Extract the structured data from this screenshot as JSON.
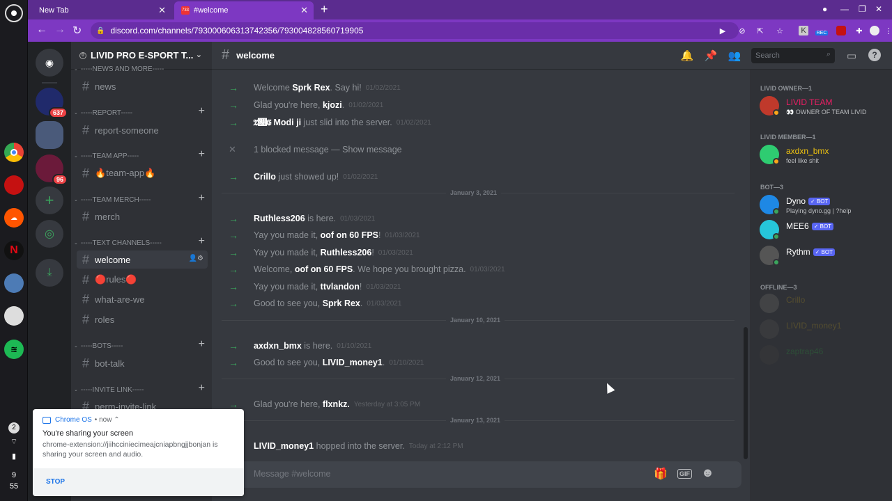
{
  "browser": {
    "tabs": [
      {
        "title": "New Tab"
      },
      {
        "title": "#welcome",
        "badge": "733"
      }
    ],
    "url": "discord.com/channels/793000606313742356/793004828560719905",
    "ext_rec": "REC"
  },
  "os": {
    "notif_count": "2",
    "clock_hour": "9",
    "clock_min": "55"
  },
  "guilds": [
    {
      "badge": "637"
    },
    {
      "badge": null
    },
    {
      "badge": "96"
    }
  ],
  "server": {
    "name": "LIVID PRO E-SPORT T...",
    "categories": [
      {
        "name": "-----NEWS AND MORE-----",
        "channels": [
          "news"
        ]
      },
      {
        "name": "-----REPORT-----",
        "channels": [
          "report-someone"
        ]
      },
      {
        "name": "-----TEAM APP-----",
        "channels": [
          "🔥team-app🔥"
        ]
      },
      {
        "name": "-----TEAM MERCH-----",
        "channels": [
          "merch"
        ]
      },
      {
        "name": "-----TEXT CHANNELS-----",
        "channels": [
          "welcome",
          "🔴rules🔴",
          "what-are-we",
          "roles"
        ]
      },
      {
        "name": "-----BOTS-----",
        "channels": [
          "bot-talk"
        ]
      },
      {
        "name": "-----INVITE LINK-----",
        "channels": [
          "perm-invite-link"
        ]
      }
    ]
  },
  "chat": {
    "channel": "welcome",
    "search_placeholder": "Search",
    "composer_placeholder": "Message #welcome",
    "composer_gif": "GIF",
    "messages": [
      {
        "pre": "Welcome ",
        "name": "Sprk Rex",
        "post": ". Say hi!",
        "ts": "01/02/2021"
      },
      {
        "pre": "Glad you're here, ",
        "name": "kjozi",
        "post": ".",
        "ts": "01/02/2021"
      },
      {
        "pre": "",
        "name": "𝔗𝔋𝔈 Modi ji",
        "post": " just slid into the server.",
        "ts": "01/02/2021"
      },
      {
        "pre": "1 blocked message — ",
        "name": "",
        "post": "Show message",
        "ts": ""
      },
      {
        "pre": "",
        "name": "Crillo",
        "post": " just showed up!",
        "ts": "01/02/2021"
      },
      {
        "pre": "",
        "name": "Ruthless206",
        "post": " is here.",
        "ts": "01/03/2021"
      },
      {
        "pre": "Yay you made it, ",
        "name": "oof on 60 FPS",
        "post": "!",
        "ts": "01/03/2021"
      },
      {
        "pre": "Yay you made it, ",
        "name": "Ruthless206",
        "post": "!",
        "ts": "01/03/2021"
      },
      {
        "pre": "Welcome, ",
        "name": "oof on 60 FPS",
        "post": ". We hope you brought pizza.",
        "ts": "01/03/2021"
      },
      {
        "pre": "Yay you made it, ",
        "name": "ttvlandon",
        "post": "!",
        "ts": "01/03/2021"
      },
      {
        "pre": "Good to see you, ",
        "name": "Sprk Rex",
        "post": ".",
        "ts": "01/03/2021"
      },
      {
        "pre": "",
        "name": "axdxn_bmx",
        "post": " is here.",
        "ts": "01/10/2021"
      },
      {
        "pre": "Good to see you, ",
        "name": "LIVID_money1",
        "post": ".",
        "ts": "01/10/2021"
      },
      {
        "pre": "Glad you're here, ",
        "name": "flxnkz.",
        "post": "",
        "ts": "Yesterday at 3:05 PM"
      },
      {
        "pre": "",
        "name": "LIVID_money1",
        "post": " hopped into the server.",
        "ts": "Today at 2:12 PM"
      }
    ],
    "dividers": [
      "January 3, 2021",
      "January 10, 2021",
      "January 12, 2021",
      "January 13, 2021"
    ]
  },
  "members": {
    "groups": [
      {
        "label": "LIVID OWNER—1",
        "members": [
          {
            "name": "LIVID TEAM",
            "sub": "👀 OWNER OF TEAM LIVID",
            "color": "#e91e63",
            "bot": false
          }
        ]
      },
      {
        "label": "LIVID MEMBER—1",
        "members": [
          {
            "name": "axdxn_bmx",
            "sub": "feel like shit",
            "color": "#f1c40f",
            "bot": false
          }
        ]
      },
      {
        "label": "BOT—3",
        "members": [
          {
            "name": "Dyno",
            "sub": "Playing dyno.gg | ?help",
            "color": "#ffffff",
            "bot": true
          },
          {
            "name": "MEE6",
            "sub": "",
            "color": "#ffffff",
            "bot": true
          },
          {
            "name": "Rythm",
            "sub": "",
            "color": "#ffffff",
            "bot": true
          }
        ]
      },
      {
        "label": "OFFLINE—3",
        "members": [
          {
            "name": "Crillo",
            "sub": "",
            "color": "#7a6a2a",
            "bot": false
          },
          {
            "name": "LIVID_money1",
            "sub": "",
            "color": "#7a6a2a",
            "bot": false
          },
          {
            "name": "zaptrap46",
            "sub": "",
            "color": "#2d6b3a",
            "bot": false
          }
        ]
      }
    ],
    "bot_label": "✓ BOT"
  },
  "notification": {
    "app": "Chrome OS",
    "time": "• now ⌃",
    "title": "You're sharing your screen",
    "body": "chrome-extension://jiihcciniecimeajcniapbngjjbonjan is sharing your screen and audio.",
    "action": "STOP"
  },
  "colors": {
    "chrome_accent": "#7d38c2",
    "discord_bg": "#36393f",
    "join_arrow": "#3ba55d"
  }
}
